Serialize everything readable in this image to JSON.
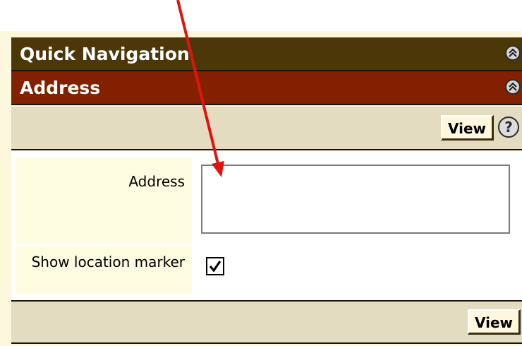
{
  "quick_navigation": {
    "title": "Quick Navigation",
    "icon": "collapse-up-icon"
  },
  "address_panel": {
    "title": "Address",
    "icon": "collapse-up-icon",
    "toolbar_top": {
      "view_label": "View",
      "help_icon": "help-icon",
      "help_glyph": "?"
    },
    "fields": {
      "address_label": "Address",
      "address_value": "",
      "show_marker_label": "Show location marker",
      "show_marker_checked": true
    },
    "toolbar_bottom": {
      "view_label": "View"
    }
  },
  "annotation": {
    "type": "red-arrow",
    "color": "#e0140f"
  },
  "colors": {
    "quick_nav_bar": "#4c3708",
    "address_bar": "#832000",
    "toolbar_bg": "#e3dcc0",
    "label_bg": "#fdfbe0",
    "page_bg": "#fdf7de"
  }
}
